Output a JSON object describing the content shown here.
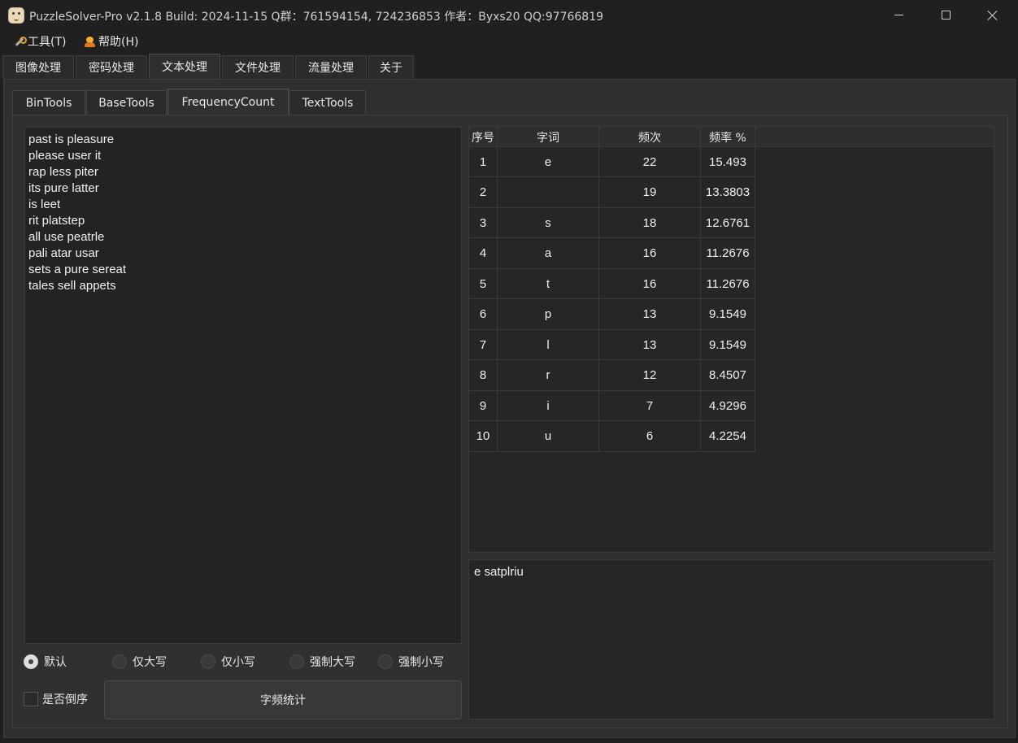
{
  "window": {
    "title": "PuzzleSolver-Pro v2.1.8  Build: 2024-11-15  Q群：761594154, 724236853  作者：Byxs20  QQ:97766819"
  },
  "menu": {
    "tools": "工具(T)",
    "help": "帮助(H)"
  },
  "top_tabs": [
    "图像处理",
    "密码处理",
    "文本处理",
    "文件处理",
    "流量处理",
    "关于"
  ],
  "inner_tabs": [
    "BinTools",
    "BaseTools",
    "FrequencyCount",
    "TextTools"
  ],
  "input_text": [
    "past is pleasure",
    "please user it",
    "rap less piter",
    "its pure latter",
    "is leet",
    "rit platstep",
    "all use peatrle",
    "pali atar usar",
    "sets a pure sereat",
    "tales sell appets"
  ],
  "options": {
    "radios": [
      "默认",
      "仅大写",
      "仅小写",
      "强制大写",
      "强制小写"
    ],
    "selected": "默认",
    "reverse_label": "是否倒序",
    "reverse_checked": false
  },
  "action_button": "字频统计",
  "table": {
    "headers": [
      "序号",
      "字词",
      "频次",
      "频率 %"
    ],
    "rows": [
      [
        "1",
        "e",
        "22",
        "15.493"
      ],
      [
        "2",
        "",
        "19",
        "13.3803"
      ],
      [
        "3",
        "s",
        "18",
        "12.6761"
      ],
      [
        "4",
        "a",
        "16",
        "11.2676"
      ],
      [
        "5",
        "t",
        "16",
        "11.2676"
      ],
      [
        "6",
        "p",
        "13",
        "9.1549"
      ],
      [
        "7",
        "l",
        "13",
        "9.1549"
      ],
      [
        "8",
        "r",
        "12",
        "8.4507"
      ],
      [
        "9",
        "i",
        "7",
        "4.9296"
      ],
      [
        "10",
        "u",
        "6",
        "4.2254"
      ]
    ]
  },
  "result_text": "e satplriu"
}
